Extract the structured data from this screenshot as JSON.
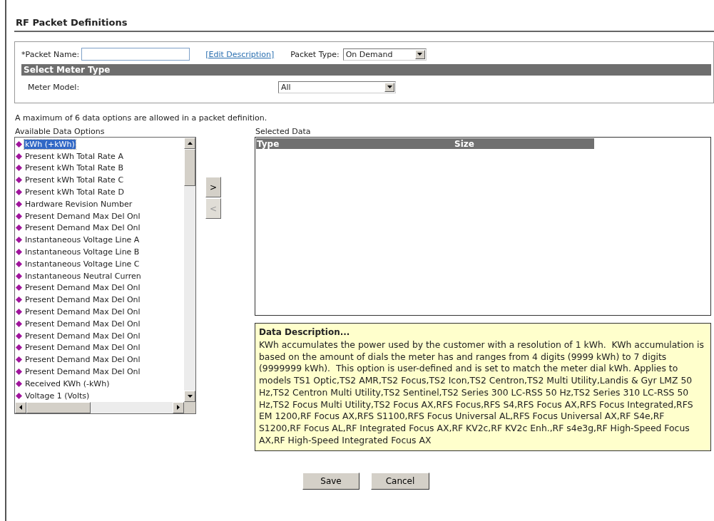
{
  "page": {
    "title": "RF Packet Definitions"
  },
  "form": {
    "packet_name_label": "*Packet Name:",
    "edit_description_link": "[Edit Description]",
    "packet_type_label": "Packet Type:",
    "packet_type_value": "On Demand",
    "section_header": "Select Meter Type",
    "meter_model_label": "Meter Model:",
    "meter_model_value": "All"
  },
  "notice": "A maximum of 6 data options are allowed in a packet definition.",
  "available": {
    "label": "Available Data Options",
    "items": [
      {
        "label": "kWh (+kWh)",
        "selected": true
      },
      {
        "label": "Present kWh Total Rate A",
        "selected": false
      },
      {
        "label": "Present kWh Total Rate B",
        "selected": false
      },
      {
        "label": "Present kWh Total Rate C",
        "selected": false
      },
      {
        "label": "Present kWh Total Rate D",
        "selected": false
      },
      {
        "label": "Hardware Revision Number",
        "selected": false
      },
      {
        "label": "Present Demand Max Del Onl",
        "selected": false
      },
      {
        "label": "Present Demand Max Del Onl",
        "selected": false
      },
      {
        "label": "Instantaneous Voltage Line A",
        "selected": false
      },
      {
        "label": "Instantaneous Voltage Line B",
        "selected": false
      },
      {
        "label": "Instantaneous Voltage Line C",
        "selected": false
      },
      {
        "label": "Instantaneous Neutral Curren",
        "selected": false
      },
      {
        "label": "Present Demand Max Del Onl",
        "selected": false
      },
      {
        "label": "Present Demand Max Del Onl",
        "selected": false
      },
      {
        "label": "Present Demand Max Del Onl",
        "selected": false
      },
      {
        "label": "Present Demand Max Del Onl",
        "selected": false
      },
      {
        "label": "Present Demand Max Del Onl",
        "selected": false
      },
      {
        "label": "Present Demand Max Del Onl",
        "selected": false
      },
      {
        "label": "Present Demand Max Del Onl",
        "selected": false
      },
      {
        "label": "Present Demand Max Del Onl",
        "selected": false
      },
      {
        "label": "Received KWh (-kWh)",
        "selected": false
      },
      {
        "label": "Voltage 1 (Volts)",
        "selected": false
      }
    ]
  },
  "move_buttons": [
    {
      "label": ">",
      "disabled": false
    },
    {
      "label": "<",
      "disabled": true
    }
  ],
  "selected_data": {
    "label": "Selected Data",
    "columns": [
      "Type",
      "Size"
    ]
  },
  "description": {
    "title": "Data Description...",
    "text": "KWh accumulates the power used by the customer with a resolution of 1 kWh.  KWh accumulation is based on the amount of dials the meter has and ranges from 4 digits (9999 kWh) to 7 digits (9999999 kWh).  This option is user-defined and is set to match the meter dial kWh. Applies to models TS1 Optic,TS2 AMR,TS2 Focus,TS2 Icon,TS2 Centron,TS2 Multi Utility,Landis & Gyr LMZ 50 Hz,TS2 Centron Multi Utility,TS2 Sentinel,TS2 Series 300 LC-RSS 50 Hz,TS2 Series 310 LC-RSS 50 Hz,TS2 Focus Multi Utility,TS2 Focus AX,RFS Focus,RFS S4,RFS Focus AX,RFS Focus Integrated,RFS EM 1200,RF Focus AX,RFS S1100,RFS Focus Universal AL,RFS Focus Universal AX,RF S4e,RF S1200,RF Focus AL,RF Integrated Focus AX,RF KV2c,RF KV2c Enh.,RF s4e3g,RF High-Speed Focus AX,RF High-Speed Integrated Focus AX"
  },
  "buttons": [
    "Save",
    "Cancel"
  ]
}
